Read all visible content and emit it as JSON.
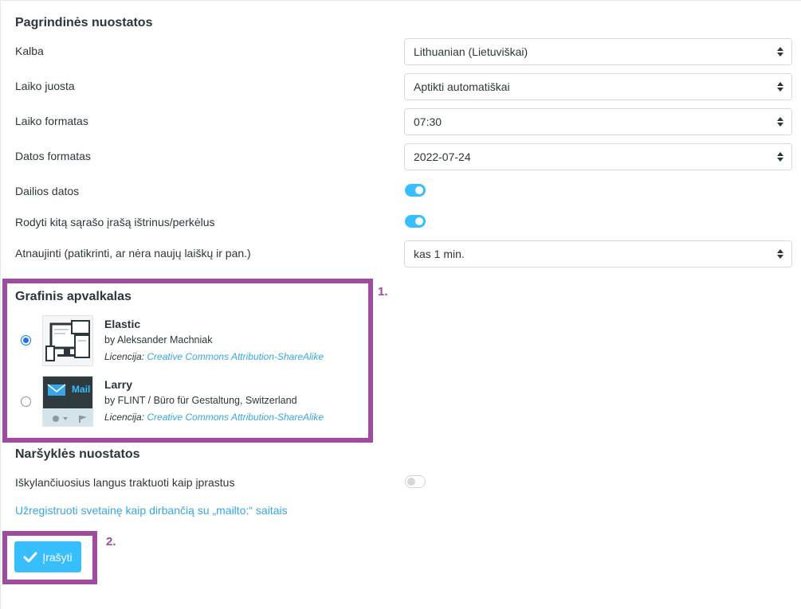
{
  "general": {
    "title": "Pagrindinės nuostatos",
    "rows": [
      {
        "label": "Kalba",
        "value": "Lithuanian (Lietuviškai)"
      },
      {
        "label": "Laiko juosta",
        "value": "Aptikti automatiškai"
      },
      {
        "label": "Laiko formatas",
        "value": "07:30"
      },
      {
        "label": "Datos formatas",
        "value": "2022-07-24"
      }
    ],
    "toggles": [
      {
        "label": "Dailios datos",
        "on": true
      },
      {
        "label": "Rodyti kitą sąrašo įrašą ištrinus/perkėlus",
        "on": true
      }
    ],
    "refresh": {
      "label": "Atnaujinti (patikrinti, ar nėra naujų laiškų ir pan.)",
      "value": "kas 1 min."
    }
  },
  "skins": {
    "title": "Grafinis apvalkalas",
    "items": [
      {
        "name": "Elastic",
        "author": "by Aleksander Machniak",
        "license_prefix": "Licencija:",
        "license": "Creative Commons Attribution-ShareAlike",
        "selected": true
      },
      {
        "name": "Larry",
        "author": "by FLINT / Büro für Gestaltung, Switzerland",
        "license_prefix": "Licencija:",
        "license": "Creative Commons Attribution-ShareAlike",
        "selected": false,
        "thumb_text": "Mail"
      }
    ]
  },
  "browser": {
    "title": "Naršyklės nuostatos",
    "popup_toggle": {
      "label": "Iškylančiuosius langus traktuoti kaip įprastus",
      "on": false
    },
    "mailto_link": "Užregistruoti svetainę kaip dirbančią su „mailto:“ saitais"
  },
  "save_button": {
    "label": "Įrašyti",
    "icon": "check-icon"
  },
  "annotations": {
    "one": "1.",
    "two": "2."
  },
  "colors": {
    "accent": "#37beff",
    "link": "#37a6e6",
    "highlight": "#9e4ba0"
  }
}
